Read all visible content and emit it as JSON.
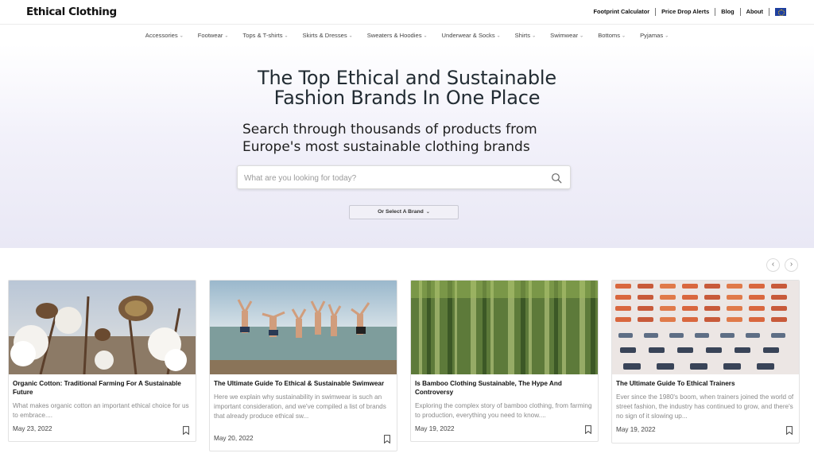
{
  "header": {
    "logo": "Ethical Clothing",
    "links": [
      "Footprint Calculator",
      "Price Drop Alerts",
      "Blog",
      "About"
    ],
    "flag_icon": "eu-flag-icon"
  },
  "nav": {
    "categories": [
      "Accessories",
      "Footwear",
      "Tops & T-shirts",
      "Skirts & Dresses",
      "Sweaters & Hoodies",
      "Underwear & Socks",
      "Shirts",
      "Swimwear",
      "Bottoms",
      "Pyjamas"
    ]
  },
  "hero": {
    "title_line1": "The Top Ethical and Sustainable",
    "title_line2": "Fashion Brands In One Place",
    "sub_line1": "Search through thousands of products from",
    "sub_line2": "Europe's most sustainable clothing brands",
    "search_placeholder": "What are you looking for today?",
    "brand_select": "Or Select A Brand"
  },
  "carousel": {
    "prev": "‹",
    "next": "›"
  },
  "articles": [
    {
      "title": "Organic Cotton: Traditional Farming For A Sustainable Future",
      "excerpt": "What makes organic cotton an important ethical choice for us to embrace....",
      "date": "May 23, 2022",
      "image": "cotton-plant-image"
    },
    {
      "title": "The Ultimate Guide To Ethical & Sustainable Swimwear",
      "excerpt": "Here we explain why sustainability in swimwear is such an important consideration, and we've compiled a list of brands that already produce ethical sw...",
      "date": "May 20, 2022",
      "image": "jumping-friends-image"
    },
    {
      "title": "Is Bamboo Clothing Sustainable, The Hype And Controversy",
      "excerpt": "Exploring the complex story of bamboo clothing, from farming to production, everything you need to know....",
      "date": "May 19, 2022",
      "image": "bamboo-forest-image"
    },
    {
      "title": "The Ultimate Guide To Ethical Trainers",
      "excerpt": "Ever since the 1980's boom, when trainers joined the world of street fashion, the industry has continued to grow, and there's no sign of it slowing up...",
      "date": "May 19, 2022",
      "image": "trainers-wall-image"
    }
  ],
  "colors": {
    "hero_bg": "#ecebf7",
    "title": "#222c33",
    "muted": "#8a8a8a"
  }
}
